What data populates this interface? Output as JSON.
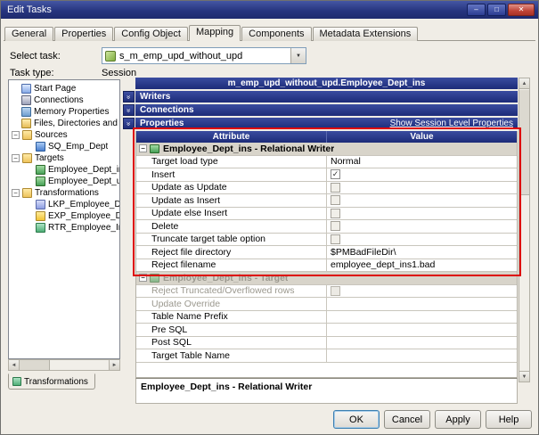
{
  "window": {
    "title": "Edit Tasks"
  },
  "tabs": [
    {
      "label": "General",
      "active": false
    },
    {
      "label": "Properties",
      "active": false
    },
    {
      "label": "Config Object",
      "active": false
    },
    {
      "label": "Mapping",
      "active": true
    },
    {
      "label": "Components",
      "active": false
    },
    {
      "label": "Metadata Extensions",
      "active": false
    }
  ],
  "task": {
    "select_label": "Select task:",
    "task_value": "s_m_emp_upd_without_upd",
    "type_label": "Task type:",
    "type_value": "Session"
  },
  "tree": {
    "footer_tab": "Transformations",
    "items": [
      {
        "label": "Start Page",
        "icon": "start-page-icon",
        "level": 0,
        "expander": null
      },
      {
        "label": "Connections",
        "icon": "connections-icon",
        "level": 0,
        "expander": null
      },
      {
        "label": "Memory Properties",
        "icon": "memory-properties-icon",
        "level": 0,
        "expander": null
      },
      {
        "label": "Files, Directories and Com",
        "icon": "files-directories-icon",
        "level": 0,
        "expander": null
      },
      {
        "label": "Sources",
        "icon": "folder-icon",
        "level": 0,
        "expander": "minus"
      },
      {
        "label": "SQ_Emp_Dept",
        "icon": "source-qualifier-icon",
        "level": 1,
        "expander": null
      },
      {
        "label": "Targets",
        "icon": "folder-icon",
        "level": 0,
        "expander": "minus"
      },
      {
        "label": "Employee_Dept_ins",
        "icon": "target-icon",
        "level": 1,
        "expander": null
      },
      {
        "label": "Employee_Dept_upd",
        "icon": "target-icon",
        "level": 1,
        "expander": null
      },
      {
        "label": "Transformations",
        "icon": "folder-icon",
        "level": 0,
        "expander": "minus"
      },
      {
        "label": "LKP_Employee_Dept",
        "icon": "lookup-icon",
        "level": 1,
        "expander": null
      },
      {
        "label": "EXP_Employee_Dept",
        "icon": "expression-icon",
        "level": 1,
        "expander": null
      },
      {
        "label": "RTR_Employee_Ins_U",
        "icon": "router-icon",
        "level": 1,
        "expander": null
      }
    ]
  },
  "panel": {
    "header": "m_emp_upd_without_upd.Employee_Dept_ins",
    "sections": [
      "Writers",
      "Connections",
      "Properties"
    ],
    "session_link": "Show Session Level Properties",
    "table": {
      "headers": [
        "Attribute",
        "Value"
      ],
      "groups": [
        {
          "title": "Employee_Dept_ins - Relational Writer",
          "disabled": false,
          "rows": [
            {
              "attr": "Target load type",
              "type": "text",
              "value": "Normal"
            },
            {
              "attr": "Insert",
              "type": "checkbox",
              "checked": true
            },
            {
              "attr": "Update as Update",
              "type": "checkbox",
              "checked": false
            },
            {
              "attr": "Update as Insert",
              "type": "checkbox",
              "checked": false
            },
            {
              "attr": "Update else Insert",
              "type": "checkbox",
              "checked": false
            },
            {
              "attr": "Delete",
              "type": "checkbox",
              "checked": false
            },
            {
              "attr": "Truncate target table option",
              "type": "checkbox",
              "checked": false
            },
            {
              "attr": "Reject file directory",
              "type": "text",
              "value": "$PMBadFileDir\\"
            },
            {
              "attr": "Reject filename",
              "type": "text",
              "value": "employee_dept_ins1.bad"
            }
          ]
        },
        {
          "title": "Employee_Dept_ins - Target",
          "disabled": true,
          "rows": [
            {
              "attr": "Reject Truncated/Overflowed rows",
              "type": "checkbox",
              "checked": false,
              "disabled": true
            },
            {
              "attr": "Update Override",
              "type": "text",
              "value": "",
              "disabled": true
            },
            {
              "attr": "Table Name Prefix",
              "type": "text",
              "value": ""
            },
            {
              "attr": "Pre SQL",
              "type": "text",
              "value": ""
            },
            {
              "attr": "Post SQL",
              "type": "text",
              "value": ""
            },
            {
              "attr": "Target Table Name",
              "type": "text",
              "value": ""
            }
          ]
        }
      ]
    },
    "description": "Employee_Dept_ins - Relational Writer"
  },
  "buttons": [
    {
      "label": "OK",
      "default": true
    },
    {
      "label": "Cancel",
      "default": false
    },
    {
      "label": "Apply",
      "default": false
    },
    {
      "label": "Help",
      "default": false
    }
  ]
}
